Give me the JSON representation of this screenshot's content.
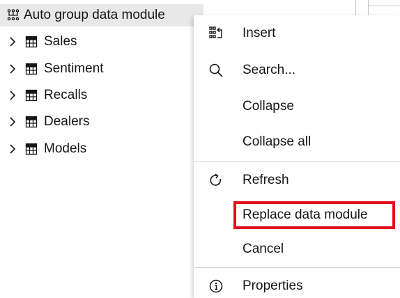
{
  "tree": {
    "root": {
      "label": "Auto group data module",
      "icon": "data-module-icon"
    },
    "items": [
      {
        "label": "Sales",
        "icon": "table-icon"
      },
      {
        "label": "Sentiment",
        "icon": "table-icon"
      },
      {
        "label": "Recalls",
        "icon": "table-icon"
      },
      {
        "label": "Dealers",
        "icon": "table-icon"
      },
      {
        "label": "Models",
        "icon": "table-icon"
      }
    ]
  },
  "context_menu": {
    "insert": {
      "label": "Insert",
      "icon": "insert-icon"
    },
    "search": {
      "label": "Search...",
      "icon": "search-icon"
    },
    "collapse": {
      "label": "Collapse"
    },
    "collapse_all": {
      "label": "Collapse all"
    },
    "refresh": {
      "label": "Refresh",
      "icon": "refresh-icon"
    },
    "replace_data_module": {
      "label": "Replace data module",
      "highlight_color": "#e0111b"
    },
    "cancel": {
      "label": "Cancel"
    },
    "properties": {
      "label": "Properties",
      "icon": "info-icon"
    }
  }
}
